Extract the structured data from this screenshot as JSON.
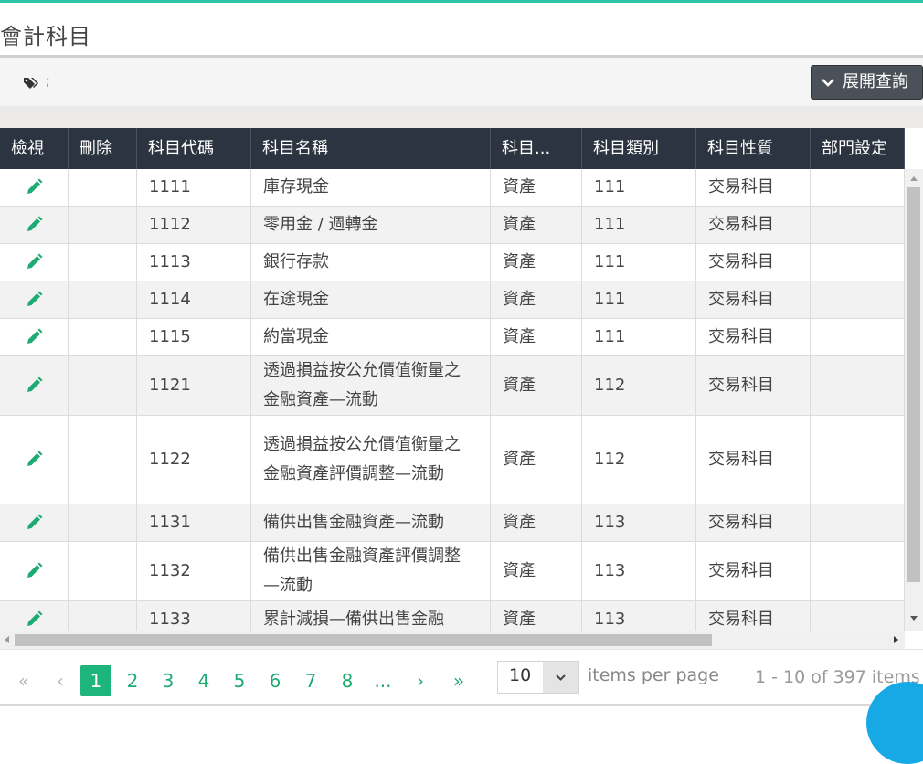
{
  "page": {
    "title": "會計科目"
  },
  "query": {
    "tag_text": ";",
    "expand_label": "展開查詢"
  },
  "columns": [
    "檢視",
    "刪除",
    "科目代碼",
    "科目名稱",
    "科目...",
    "科目類別",
    "科目性質",
    "部門設定"
  ],
  "rows": [
    {
      "code": "1111",
      "name": "庫存現金",
      "cls": "資產",
      "cat": "111",
      "nature": "交易科目",
      "dept": ""
    },
    {
      "code": "1112",
      "name": "零用金 / 週轉金",
      "cls": "資產",
      "cat": "111",
      "nature": "交易科目",
      "dept": ""
    },
    {
      "code": "1113",
      "name": "銀行存款",
      "cls": "資產",
      "cat": "111",
      "nature": "交易科目",
      "dept": ""
    },
    {
      "code": "1114",
      "name": "在途現金",
      "cls": "資產",
      "cat": "111",
      "nature": "交易科目",
      "dept": ""
    },
    {
      "code": "1115",
      "name": "約當現金",
      "cls": "資產",
      "cat": "111",
      "nature": "交易科目",
      "dept": ""
    },
    {
      "code": "1121",
      "name": "透過損益按公允價值衡量之金融資產—流動",
      "cls": "資產",
      "cat": "112",
      "nature": "交易科目",
      "dept": ""
    },
    {
      "code": "1122",
      "name": "透過損益按公允價值衡量之金融資產評價調整—流動",
      "cls": "資產",
      "cat": "112",
      "nature": "交易科目",
      "dept": ""
    },
    {
      "code": "1131",
      "name": "備供出售金融資產—流動",
      "cls": "資產",
      "cat": "113",
      "nature": "交易科目",
      "dept": ""
    },
    {
      "code": "1132",
      "name": "備供出售金融資產評價調整—流動",
      "cls": "資產",
      "cat": "113",
      "nature": "交易科目",
      "dept": ""
    },
    {
      "code": "1133",
      "name": "累計減損—備供出售金融",
      "cls": "資產",
      "cat": "113",
      "nature": "交易科目",
      "dept": ""
    }
  ],
  "pager": {
    "first": "«",
    "prev": "‹",
    "next": "›",
    "last": "»",
    "pages": [
      "1",
      "2",
      "3",
      "4",
      "5",
      "6",
      "7",
      "8",
      "..."
    ],
    "current": "1",
    "page_size": "10",
    "items_per_page": "items per page",
    "range": "1 - 10 of 397 items"
  },
  "colors": {
    "header_bg": "#2b3440",
    "accent": "#1db57c",
    "pencil": "#1eaa73"
  },
  "icons": {
    "edit": "pencil-icon",
    "tag": "tags-icon",
    "expand": "chevron-down-icon"
  }
}
